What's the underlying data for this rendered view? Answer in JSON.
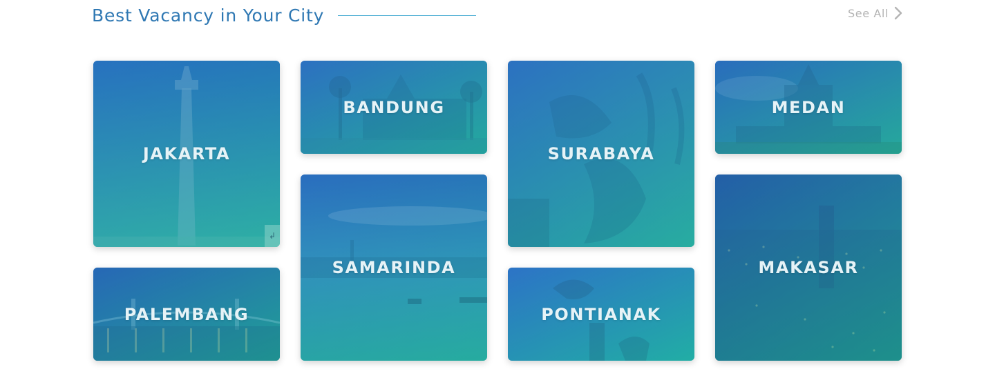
{
  "section": {
    "title": "Best Vacancy in Your City",
    "see_all_label": "See All"
  },
  "colors": {
    "title": "#2f78b3",
    "overlay_start": "#2e73c8",
    "overlay_end": "#1faaa0"
  },
  "cities": [
    {
      "name": "JAKARTA"
    },
    {
      "name": "BANDUNG"
    },
    {
      "name": "SURABAYA"
    },
    {
      "name": "MEDAN"
    },
    {
      "name": "PALEMBANG"
    },
    {
      "name": "SAMARINDA"
    },
    {
      "name": "PONTIANAK"
    },
    {
      "name": "MAKASAR"
    }
  ]
}
